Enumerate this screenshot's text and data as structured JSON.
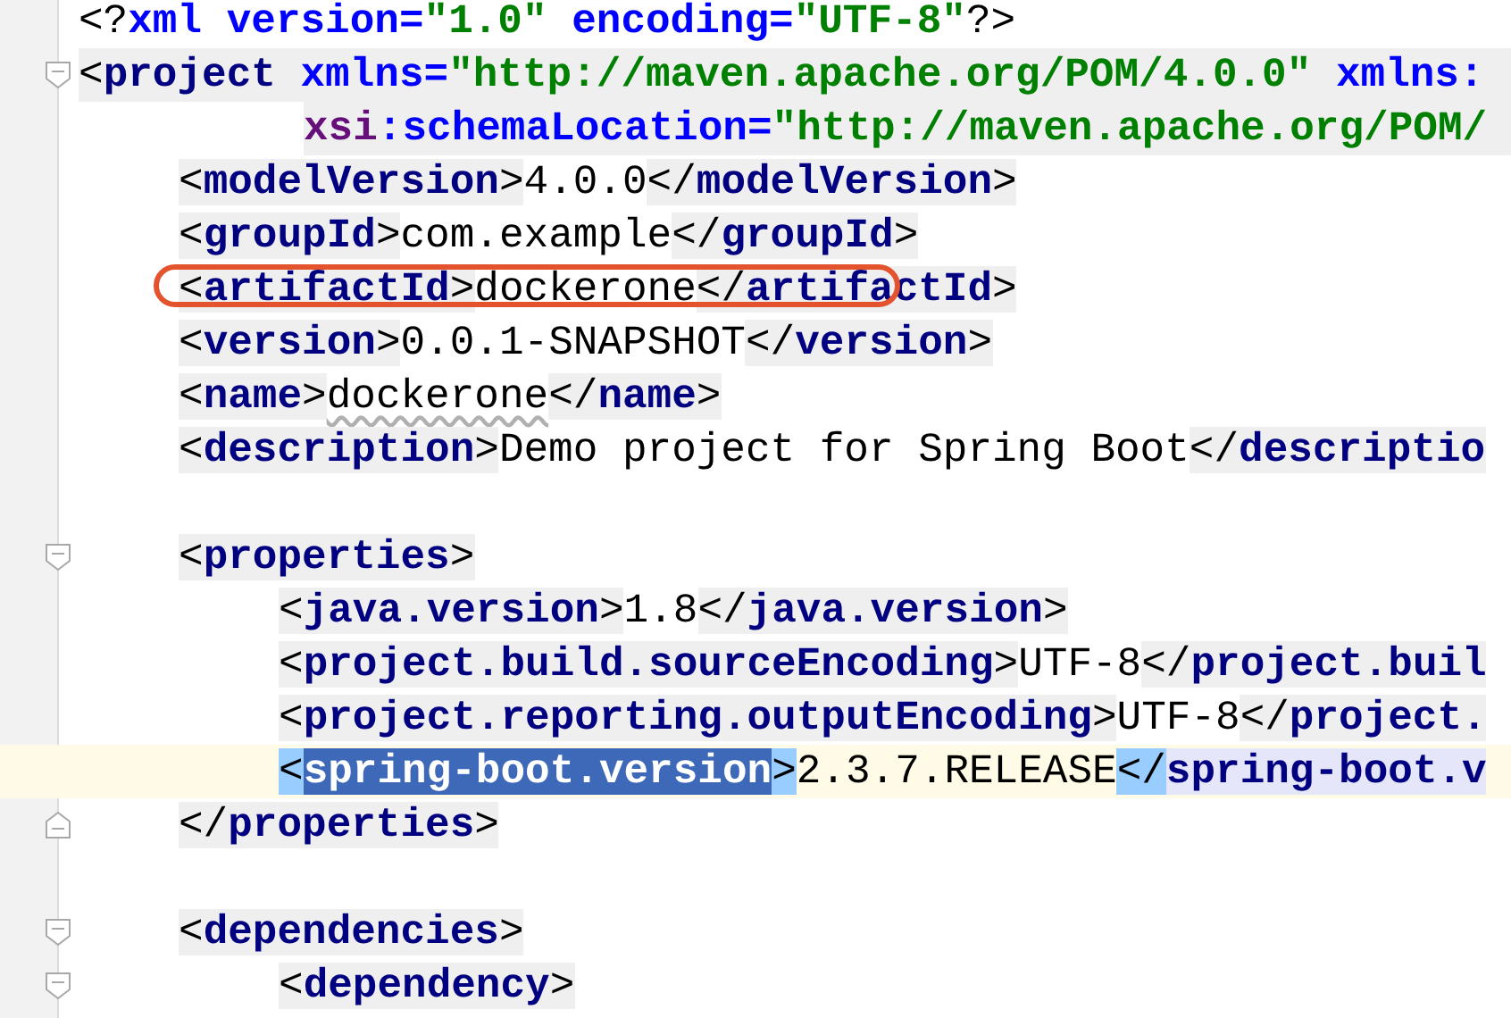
{
  "editor": {
    "lines": [
      {
        "segments": [
          {
            "text": "<?",
            "kind": "pi"
          },
          {
            "text": "xml",
            "kind": "attr"
          },
          {
            "text": " version",
            "kind": "attr"
          },
          {
            "text": "=",
            "kind": "attr"
          },
          {
            "text": "\"1.0\"",
            "kind": "value"
          },
          {
            "text": " encoding",
            "kind": "attr"
          },
          {
            "text": "=",
            "kind": "attr"
          },
          {
            "text": "\"UTF-8\"",
            "kind": "value"
          },
          {
            "text": "?>",
            "kind": "pi"
          }
        ]
      },
      {
        "fold_start": true,
        "shaded": true,
        "segments": [
          {
            "text": "<",
            "kind": "punct"
          },
          {
            "text": "project",
            "kind": "tag"
          },
          {
            "text": " xmlns",
            "kind": "attr"
          },
          {
            "text": "=",
            "kind": "attr"
          },
          {
            "text": "\"http://maven.apache.org/POM/4.0.0\"",
            "kind": "value"
          },
          {
            "text": " xmlns:",
            "kind": "attr"
          }
        ],
        "children": [
          {
            "kind": "continuation",
            "shaded": true,
            "segments": [
              {
                "text": "xsi",
                "kind": "ns"
              },
              {
                "text": ":schemaLocation",
                "kind": "attr"
              },
              {
                "text": "=",
                "kind": "attr"
              },
              {
                "text": "\"http://maven.apache.org/POM/",
                "kind": "value"
              }
            ]
          },
          {
            "segments": [
              {
                "text": "<",
                "kind": "punct"
              },
              {
                "text": "modelVersion",
                "kind": "tag"
              },
              {
                "text": ">",
                "kind": "punct"
              },
              {
                "text": "4.0.0",
                "kind": "text"
              },
              {
                "text": "</",
                "kind": "punct"
              },
              {
                "text": "modelVersion",
                "kind": "tag"
              },
              {
                "text": ">",
                "kind": "punct"
              }
            ]
          },
          {
            "segments": [
              {
                "text": "<",
                "kind": "punct"
              },
              {
                "text": "groupId",
                "kind": "tag"
              },
              {
                "text": ">",
                "kind": "punct"
              },
              {
                "text": "com.example",
                "kind": "text"
              },
              {
                "text": "</",
                "kind": "punct"
              },
              {
                "text": "groupId",
                "kind": "tag"
              },
              {
                "text": ">",
                "kind": "punct"
              }
            ]
          },
          {
            "circled": true,
            "segments": [
              {
                "text": "<",
                "kind": "punct"
              },
              {
                "text": "artifactId",
                "kind": "tag"
              },
              {
                "text": ">",
                "kind": "punct"
              },
              {
                "text": "dockerone",
                "kind": "text"
              },
              {
                "text": "</",
                "kind": "punct"
              },
              {
                "text": "artifactId",
                "kind": "tag"
              },
              {
                "text": ">",
                "kind": "punct"
              }
            ]
          },
          {
            "segments": [
              {
                "text": "<",
                "kind": "punct"
              },
              {
                "text": "version",
                "kind": "tag"
              },
              {
                "text": ">",
                "kind": "punct"
              },
              {
                "text": "0.0.1-SNAPSHOT",
                "kind": "text"
              },
              {
                "text": "</",
                "kind": "punct"
              },
              {
                "text": "version",
                "kind": "tag"
              },
              {
                "text": ">",
                "kind": "punct"
              }
            ]
          },
          {
            "segments": [
              {
                "text": "<",
                "kind": "punct"
              },
              {
                "text": "name",
                "kind": "tag"
              },
              {
                "text": ">",
                "kind": "punct"
              },
              {
                "text": "dockerone",
                "kind": "text",
                "typo": true
              },
              {
                "text": "</",
                "kind": "punct"
              },
              {
                "text": "name",
                "kind": "tag"
              },
              {
                "text": ">",
                "kind": "punct"
              }
            ]
          },
          {
            "segments": [
              {
                "text": "<",
                "kind": "punct"
              },
              {
                "text": "description",
                "kind": "tag"
              },
              {
                "text": ">",
                "kind": "punct"
              },
              {
                "text": "Demo project for Spring Boot",
                "kind": "text"
              },
              {
                "text": "</",
                "kind": "punct"
              },
              {
                "text": "descriptio",
                "kind": "tag"
              }
            ]
          },
          {
            "kind": "blank"
          },
          {
            "fold_start": true,
            "segments": [
              {
                "text": "<",
                "kind": "punct"
              },
              {
                "text": "properties",
                "kind": "tag"
              },
              {
                "text": ">",
                "kind": "punct"
              }
            ],
            "children": [
              {
                "segments": [
                  {
                    "text": "<",
                    "kind": "punct"
                  },
                  {
                    "text": "java.version",
                    "kind": "tag"
                  },
                  {
                    "text": ">",
                    "kind": "punct"
                  },
                  {
                    "text": "1.8",
                    "kind": "text"
                  },
                  {
                    "text": "</",
                    "kind": "punct"
                  },
                  {
                    "text": "java.version",
                    "kind": "tag"
                  },
                  {
                    "text": ">",
                    "kind": "punct"
                  }
                ]
              },
              {
                "segments": [
                  {
                    "text": "<",
                    "kind": "punct"
                  },
                  {
                    "text": "project.build.sourceEncoding",
                    "kind": "tag"
                  },
                  {
                    "text": ">",
                    "kind": "punct"
                  },
                  {
                    "text": "UTF-8",
                    "kind": "text"
                  },
                  {
                    "text": "</",
                    "kind": "punct"
                  },
                  {
                    "text": "project.buil",
                    "kind": "tag"
                  }
                ]
              },
              {
                "segments": [
                  {
                    "text": "<",
                    "kind": "punct"
                  },
                  {
                    "text": "project.reporting.outputEncoding",
                    "kind": "tag"
                  },
                  {
                    "text": ">",
                    "kind": "punct"
                  },
                  {
                    "text": "UTF-8",
                    "kind": "text"
                  },
                  {
                    "text": "</",
                    "kind": "punct"
                  },
                  {
                    "text": "project.",
                    "kind": "tag"
                  }
                ]
              },
              {
                "current": true,
                "segments": [
                  {
                    "text": "<",
                    "kind": "punct",
                    "matched": true
                  },
                  {
                    "text": "spring-boot.version",
                    "kind": "tag",
                    "selected": true
                  },
                  {
                    "text": ">",
                    "kind": "punct",
                    "matched": true
                  },
                  {
                    "text": "2.3.7.RELEASE",
                    "kind": "text"
                  },
                  {
                    "text": "</",
                    "kind": "punct",
                    "matched": true
                  },
                  {
                    "text": "spring-boot.v",
                    "kind": "tag",
                    "paired": true
                  }
                ]
              }
            ]
          },
          {
            "fold_end": true,
            "segments": [
              {
                "text": "</",
                "kind": "punct"
              },
              {
                "text": "properties",
                "kind": "tag"
              },
              {
                "text": ">",
                "kind": "punct"
              }
            ]
          },
          {
            "kind": "blank"
          },
          {
            "fold_start": true,
            "segments": [
              {
                "text": "<",
                "kind": "punct"
              },
              {
                "text": "dependencies",
                "kind": "tag"
              },
              {
                "text": ">",
                "kind": "punct"
              }
            ],
            "children": [
              {
                "fold_start": true,
                "segments": [
                  {
                    "text": "<",
                    "kind": "punct"
                  },
                  {
                    "text": "dependency",
                    "kind": "tag"
                  },
                  {
                    "text": ">",
                    "kind": "punct"
                  }
                ]
              }
            ]
          }
        ]
      }
    ]
  }
}
